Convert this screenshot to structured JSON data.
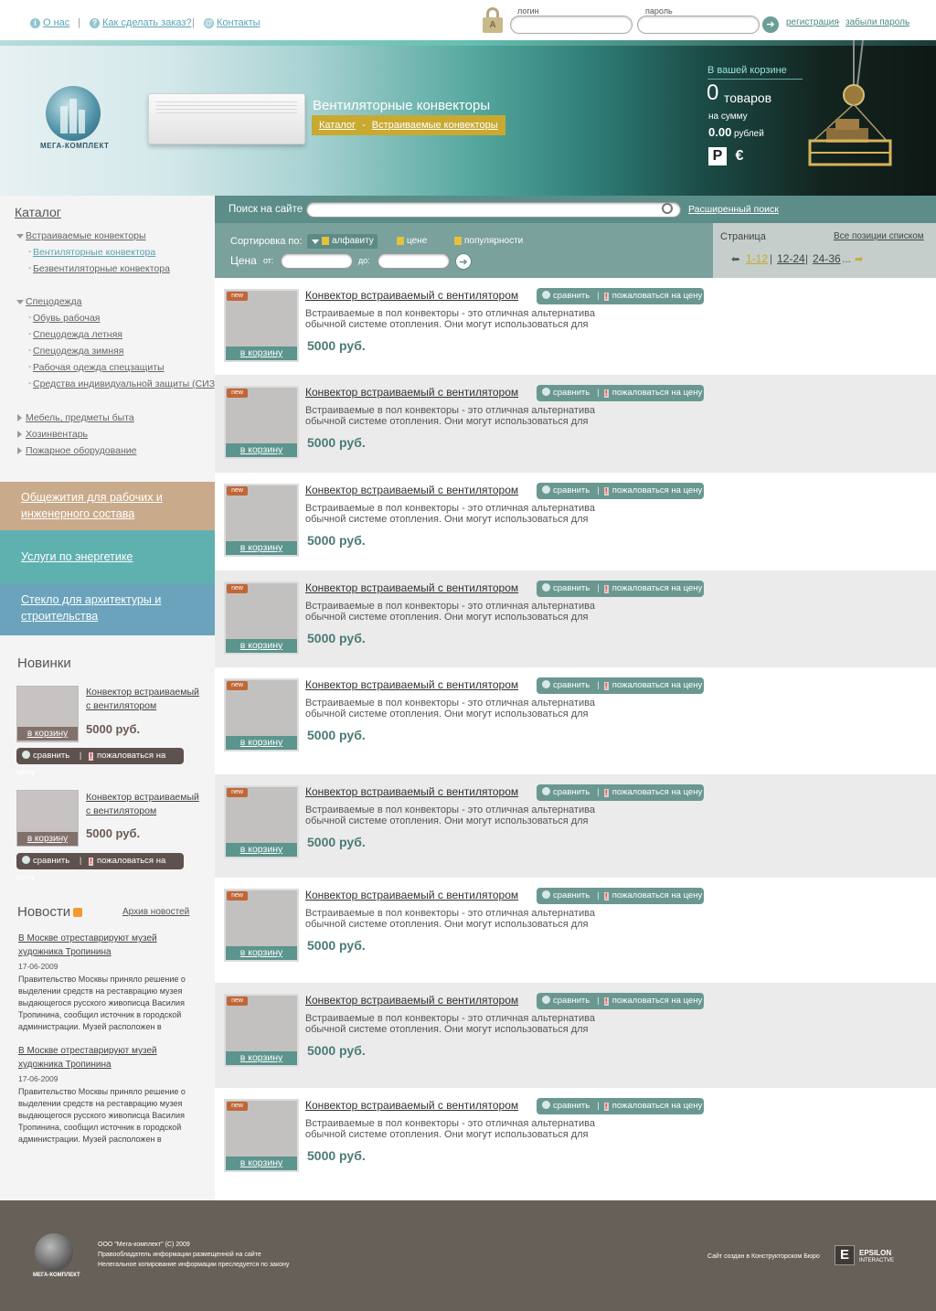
{
  "topnav": {
    "about": "О нас",
    "howto": "Как сделать заказ?",
    "contacts": "Контакты"
  },
  "login": {
    "login_label": "логин",
    "password_label": "пароль",
    "register": "регистрация",
    "dash": "-",
    "forgot": "забыли пароль"
  },
  "header": {
    "logo_text": "МЕГА-КОМПЛЕКТ",
    "title": "Вентиляторные конвекторы",
    "crumb_root": "Каталог",
    "crumb_sep": "-",
    "crumb_current": "Встраиваемые конвекторы"
  },
  "basket": {
    "title": "В вашей корзине",
    "count": "0",
    "count_word": "товаров",
    "sum_label": "на сумму",
    "amount": "0.00",
    "amount_word": "рублей",
    "cur1": "Р",
    "cur2": "€"
  },
  "sidebar": {
    "catalog_title": "Каталог",
    "cats": [
      {
        "label": "Встраиваемые конвекторы"
      },
      {
        "label": "Вентиляторные конвектора"
      },
      {
        "label": "Безвентиляторные конвектора"
      },
      {
        "label": "Спецодежда"
      },
      {
        "label": "Обувь рабочая"
      },
      {
        "label": "Спецодежда летняя"
      },
      {
        "label": "Спецодежда зимняя"
      },
      {
        "label": "Рабочая одежда спецзащиты"
      },
      {
        "label": "Средства индивидуальной защиты (СИЗ)"
      },
      {
        "label": "Мебель, предметы быта"
      },
      {
        "label": "Хозинвентарь"
      },
      {
        "label": "Пожарное оборудование"
      }
    ],
    "promo1_l1": "Общежития для рабочих и",
    "promo1_l2": "инженерного состава",
    "promo2": "Услуги по энергетике",
    "promo3_l1": "Стекло для архитектуры и",
    "promo3_l2": "строительства",
    "novelties_title": "Новинки",
    "novelties": [
      {
        "name_l1": "Конвектор встраиваемый",
        "name_l2": "с вентилятором",
        "price": "5000 руб.",
        "cart": "в корзину",
        "compare": "сравнить",
        "sep": "|",
        "complain": "пожаловаться на цену"
      },
      {
        "name_l1": "Конвектор встраиваемый",
        "name_l2": "с вентилятором",
        "price": "5000 руб.",
        "cart": "в корзину",
        "compare": "сравнить",
        "sep": "|",
        "complain": "пожаловаться на цену"
      }
    ],
    "news_title": "Новости",
    "news_archive": "Архив новостей",
    "news": [
      {
        "t1": "В Москве отреставрируют музей",
        "t2": "художника Тропинина",
        "date": "17-06-2009",
        "text": "Правительство Москвы приняло решение о выделении средств на реставрацию музея выдающегося русского живописца Василия Тропинина, сообщил источник в городской администрации. Музей расположен в"
      },
      {
        "t1": "В Москве отреставрируют музей",
        "t2": "художника Тропинина",
        "date": "17-06-2009",
        "text": "Правительство Москвы приняло решение о выделении средств на реставрацию музея выдающегося русского живописца Василия Тропинина, сообщил источник в городской администрации. Музей расположен в"
      }
    ]
  },
  "search": {
    "label": "Поиск на сайте",
    "advanced": "Расширенный поиск",
    "value": ""
  },
  "sort": {
    "label": "Сортировка по:",
    "opt1": "алфавиту",
    "opt2": "цене",
    "opt3": "популярности",
    "price_label": "Цена",
    "from": "от:",
    "to": "до:"
  },
  "pager": {
    "label": "Страница",
    "all": "Все позиции списком",
    "p1": "1-12",
    "p2": "12-24",
    "p3": "24-36",
    "sep": "|",
    "more": "..."
  },
  "products": [
    {
      "name": "Конвектор встраиваемый с вентилятором",
      "desc": "Встраиваемые в пол конвекторы - это отличная альтернатива обычной системе отопления. Они могут использоваться для",
      "price": "5000 руб.",
      "badge": "new",
      "cart": "в корзину",
      "compare": "сравнить",
      "sep": "|",
      "complain": "пожаловаться на цену"
    },
    {
      "name": "Конвектор встраиваемый с вентилятором",
      "desc": "Встраиваемые в пол конвекторы - это отличная альтернатива обычной системе отопления. Они могут использоваться для",
      "price": "5000 руб.",
      "badge": "new",
      "cart": "в корзину",
      "compare": "сравнить",
      "sep": "|",
      "complain": "пожаловаться на цену"
    },
    {
      "name": "Конвектор встраиваемый с вентилятором",
      "desc": "Встраиваемые в пол конвекторы - это отличная альтернатива обычной системе отопления. Они могут использоваться для",
      "price": "5000 руб.",
      "badge": "new",
      "cart": "в корзину",
      "compare": "сравнить",
      "sep": "|",
      "complain": "пожаловаться на цену"
    },
    {
      "name": "Конвектор встраиваемый с вентилятором",
      "desc": "Встраиваемые в пол конвекторы - это отличная альтернатива обычной системе отопления. Они могут использоваться для",
      "price": "5000 руб.",
      "badge": "new",
      "cart": "в корзину",
      "compare": "сравнить",
      "sep": "|",
      "complain": "пожаловаться на цену"
    },
    {
      "name": "Конвектор встраиваемый с вентилятором",
      "desc": "Встраиваемые в пол конвекторы - это отличная альтернатива обычной системе отопления. Они могут использоваться для",
      "price": "5000 руб.",
      "badge": "new",
      "cart": "в корзину",
      "compare": "сравнить",
      "sep": "|",
      "complain": "пожаловаться на цену"
    },
    {
      "name": "Конвектор встраиваемый с вентилятором",
      "desc": "Встраиваемые в пол конвекторы - это отличная альтернатива обычной системе отопления. Они могут использоваться для",
      "price": "5000 руб.",
      "badge": "new",
      "cart": "в корзину",
      "compare": "сравнить",
      "sep": "|",
      "complain": "пожаловаться на цену"
    },
    {
      "name": "Конвектор встраиваемый с вентилятором",
      "desc": "Встраиваемые в пол конвекторы - это отличная альтернатива обычной системе отопления. Они могут использоваться для",
      "price": "5000 руб.",
      "badge": "new",
      "cart": "в корзину",
      "compare": "сравнить",
      "sep": "|",
      "complain": "пожаловаться на цену"
    },
    {
      "name": "Конвектор встраиваемый с вентилятором",
      "desc": "Встраиваемые в пол конвекторы - это отличная альтернатива обычной системе отопления. Они могут использоваться для",
      "price": "5000 руб.",
      "badge": "new",
      "cart": "в корзину",
      "compare": "сравнить",
      "sep": "|",
      "complain": "пожаловаться на цену"
    },
    {
      "name": "Конвектор встраиваемый с вентилятором",
      "desc": "Встраиваемые в пол конвекторы - это отличная альтернатива обычной системе отопления. Они могут использоваться для",
      "price": "5000 руб.",
      "badge": "new",
      "cart": "в корзину",
      "compare": "сравнить",
      "sep": "|",
      "complain": "пожаловаться на цену"
    }
  ],
  "footer": {
    "logo_text": "МЕГА-КОМПЛЕКТ",
    "l1": "ООО \"Мега-комплект\" (С) 2009",
    "l2": "Правообладатель информации размещенной на сайте",
    "l3": "Нелегальное копирование информации преследуется по закону",
    "credit": "Сайт создан в Конструкторском Бюро",
    "brand1": "EPSILON",
    "brand2": "INTERACTVE"
  },
  "colors": {
    "accent": "#5c8d88",
    "crumb": "#c9a930",
    "promo1": "#c9aa8b",
    "promo2": "#5fb1b0",
    "promo3": "#6aa3bb",
    "footer": "#676058"
  }
}
